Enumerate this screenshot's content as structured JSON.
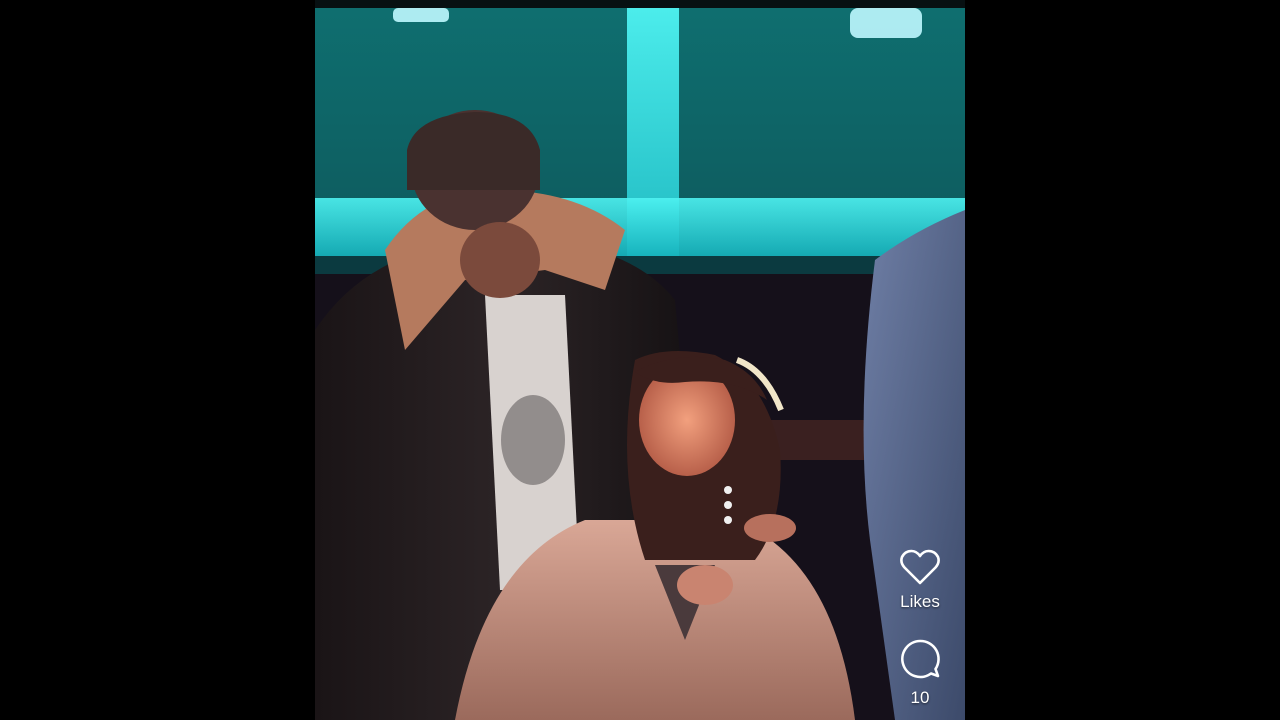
{
  "player": {
    "background": "#000000",
    "actions": {
      "like": {
        "icon": "heart-icon",
        "label": "Likes"
      },
      "comment": {
        "icon": "comment-bubble-icon",
        "count": "10"
      }
    }
  }
}
